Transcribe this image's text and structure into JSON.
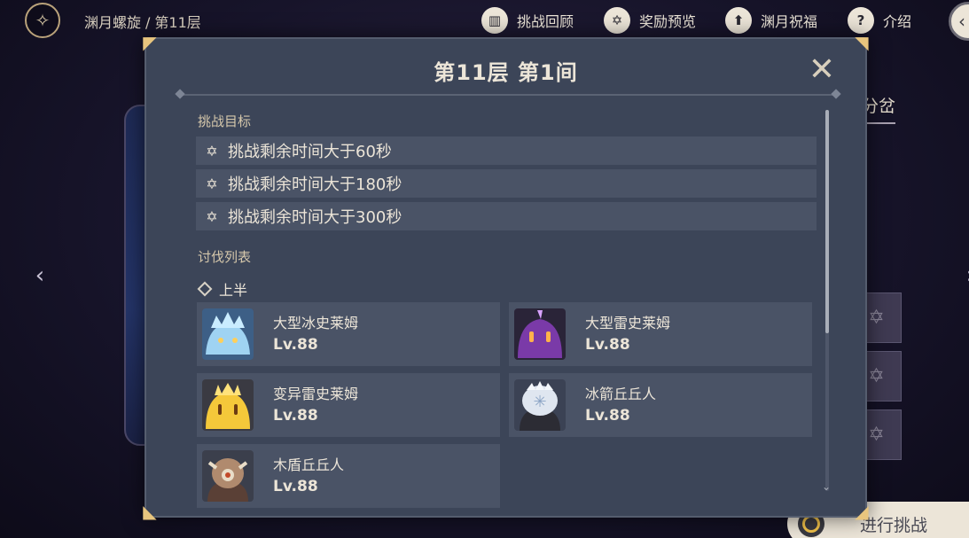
{
  "header": {
    "breadcrumb_parent": "渊月螺旋",
    "breadcrumb_sep": "/",
    "breadcrumb_current": "第11层",
    "nav": [
      {
        "label": "挑战回顾",
        "icon": "book-icon"
      },
      {
        "label": "奖励预览",
        "icon": "star-badge-icon"
      },
      {
        "label": "渊月祝福",
        "icon": "arrow-up-icon"
      },
      {
        "label": "介绍",
        "icon": "question-icon"
      }
    ]
  },
  "background": {
    "tab_label": "分岔",
    "start_button_label": "进行挑战"
  },
  "modal": {
    "title": "第11层 第1间",
    "goals_heading": "挑战目标",
    "goals": [
      "挑战剩余时间大于60秒",
      "挑战剩余时间大于180秒",
      "挑战剩余时间大于300秒"
    ],
    "enemies_heading": "讨伐列表",
    "half_label": "上半",
    "enemies": [
      {
        "name": "大型冰史莱姆",
        "level": "Lv.88",
        "icon": "ice-slime-portrait"
      },
      {
        "name": "大型雷史莱姆",
        "level": "Lv.88",
        "icon": "electro-slime-portrait"
      },
      {
        "name": "变异雷史莱姆",
        "level": "Lv.88",
        "icon": "mutant-electro-slime-portrait"
      },
      {
        "name": "冰箭丘丘人",
        "level": "Lv.88",
        "icon": "cryo-hilichurl-shooter-portrait"
      },
      {
        "name": "木盾丘丘人",
        "level": "Lv.88",
        "icon": "wooden-shield-hilichurl-portrait"
      }
    ]
  },
  "colors": {
    "modal_bg": "#3c4558",
    "row_bg": "#4a5366",
    "text": "#ece5d8",
    "accent_gold": "#e8c57e"
  }
}
